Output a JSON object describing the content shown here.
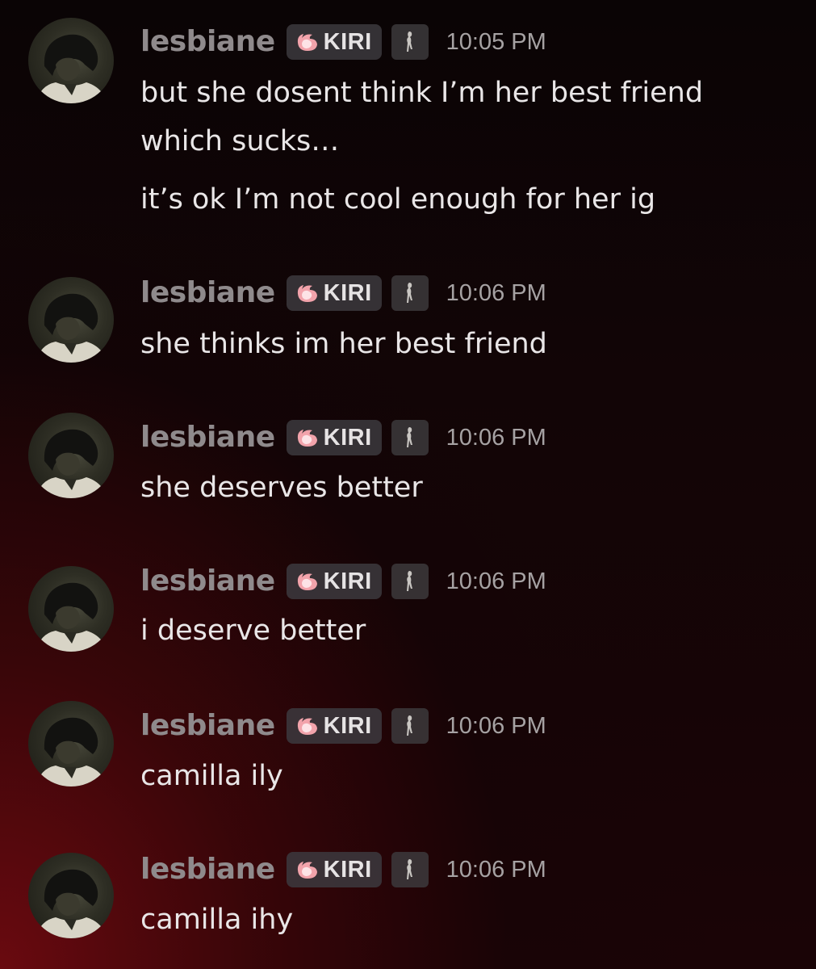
{
  "messages": [
    {
      "username": "lesbiane",
      "role": "KIRI",
      "time": "10:05 PM",
      "lines": [
        "but she dosent think I’m her best friend",
        "which sucks…",
        "it’s ok I’m not cool enough for her ig"
      ]
    },
    {
      "username": "lesbiane",
      "role": "KIRI",
      "time": "10:06 PM",
      "lines": [
        "she thinks im her best friend"
      ]
    },
    {
      "username": "lesbiane",
      "role": "KIRI",
      "time": "10:06 PM",
      "lines": [
        "she deserves better"
      ]
    },
    {
      "username": "lesbiane",
      "role": "KIRI",
      "time": "10:06 PM",
      "lines": [
        "i deserve better"
      ]
    },
    {
      "username": "lesbiane",
      "role": "KIRI",
      "time": "10:06 PM",
      "lines": [
        "camilla ily"
      ]
    },
    {
      "username": "lesbiane",
      "role": "KIRI",
      "time": "10:06 PM",
      "lines": [
        "camilla ihy"
      ]
    }
  ],
  "icons": {
    "role_icon": "flame-icon",
    "badge_icon": "figure-badge-icon"
  },
  "colors": {
    "username": "#8f8a8c",
    "message_text": "#e9e6e7",
    "role_flame": "#f0a0a8",
    "background_glow": "#6e0a10"
  }
}
